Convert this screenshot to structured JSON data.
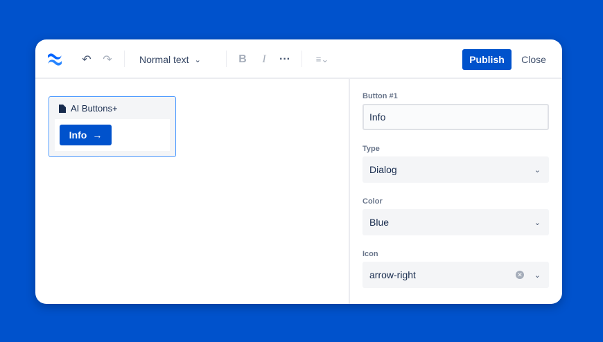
{
  "toolbar": {
    "text_style": "Normal text",
    "publish": "Publish",
    "close": "Close"
  },
  "macro": {
    "title": "AI Buttons+",
    "button_label": "Info"
  },
  "panel": {
    "button_label": "Button #1",
    "button_value": "Info",
    "type_label": "Type",
    "type_value": "Dialog",
    "color_label": "Color",
    "color_value": "Blue",
    "icon_label": "Icon",
    "icon_value": "arrow-right"
  },
  "colors": {
    "brand": "#0052cc"
  }
}
